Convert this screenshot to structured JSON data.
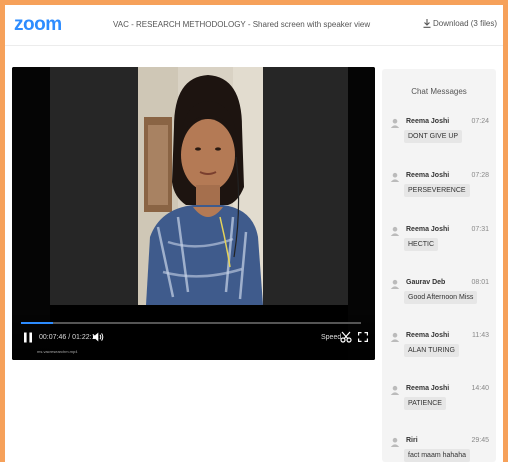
{
  "app": {
    "logo": "zoom",
    "title": "VAC - RESEARCH METHODOLOGY - Shared screen with speaker view",
    "download_label": "Download (3 files)"
  },
  "colors": {
    "brand": "#2d8cff",
    "border": "#f6a15a"
  },
  "player": {
    "current_time": "00:07:46",
    "duration": "01:22:11",
    "progress_percent": 9.5,
    "caption": "ms.vacresearchm.mp4",
    "speed_label": "Speed"
  },
  "chat": {
    "title": "Chat Messages",
    "messages": [
      {
        "sender": "Reema Joshi",
        "time": "07:24",
        "text": "DONT GIVE UP"
      },
      {
        "sender": "Reema Joshi",
        "time": "07:28",
        "text": "PERSEVERENCE"
      },
      {
        "sender": "Reema Joshi",
        "time": "07:31",
        "text": "HECTIC"
      },
      {
        "sender": "Gaurav Deb",
        "time": "08:01",
        "text": "Good Afternoon Miss"
      },
      {
        "sender": "Reema Joshi",
        "time": "11:43",
        "text": "ALAN TURING"
      },
      {
        "sender": "Reema Joshi",
        "time": "14:40",
        "text": "PATIENCE"
      },
      {
        "sender": "Riri",
        "time": "29:45",
        "text": "fact maam hahaha"
      }
    ]
  }
}
